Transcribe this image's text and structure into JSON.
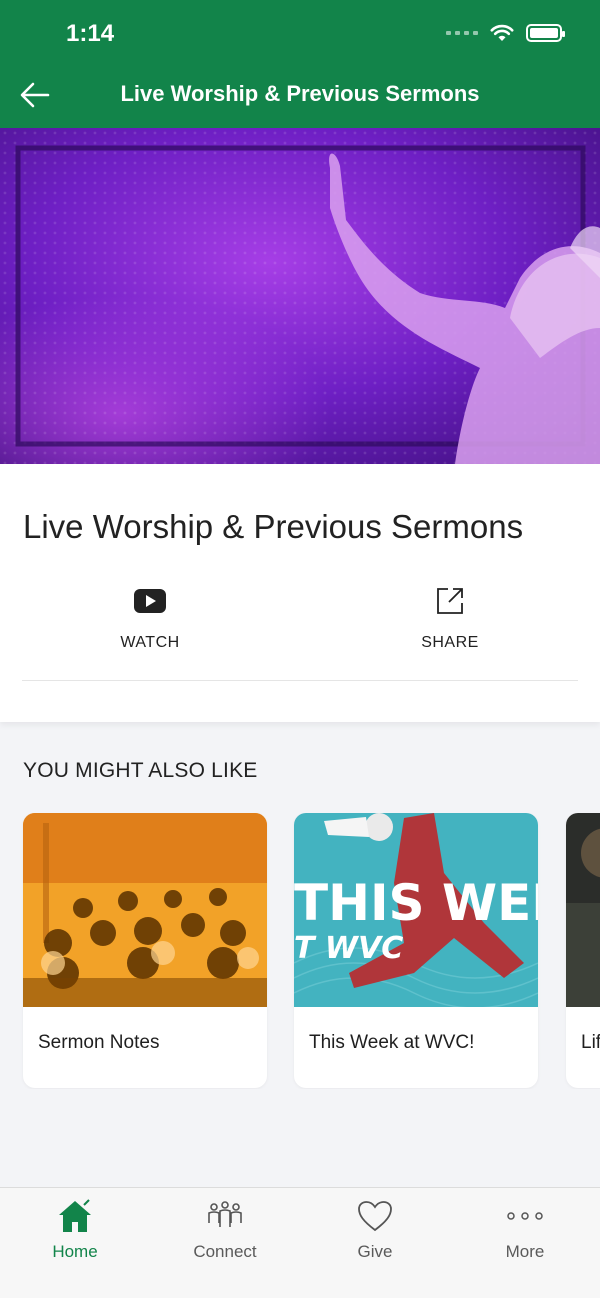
{
  "status_bar": {
    "time": "1:14"
  },
  "header": {
    "title": "Live Worship & Previous Sermons"
  },
  "content": {
    "title": "Live Worship & Previous Sermons",
    "actions": [
      {
        "label": "WATCH",
        "icon": "youtube-play-icon"
      },
      {
        "label": "SHARE",
        "icon": "share-icon"
      }
    ]
  },
  "recommendations": {
    "heading": "YOU MIGHT ALSO LIKE",
    "cards": [
      {
        "label": "Sermon Notes",
        "image_text": ""
      },
      {
        "label": "This Week at WVC!",
        "image_text_line1": "THIS WEEK",
        "image_text_line2": "T WVC"
      },
      {
        "label": "Lif"
      }
    ]
  },
  "tabbar": {
    "tabs": [
      {
        "label": "Home",
        "icon": "home-icon",
        "active": true
      },
      {
        "label": "Connect",
        "icon": "people-icon",
        "active": false
      },
      {
        "label": "Give",
        "icon": "heart-icon",
        "active": false
      },
      {
        "label": "More",
        "icon": "more-dots-icon",
        "active": false
      }
    ]
  },
  "colors": {
    "brand_green": "#12844a",
    "hero_purple": "#7a20c8"
  }
}
